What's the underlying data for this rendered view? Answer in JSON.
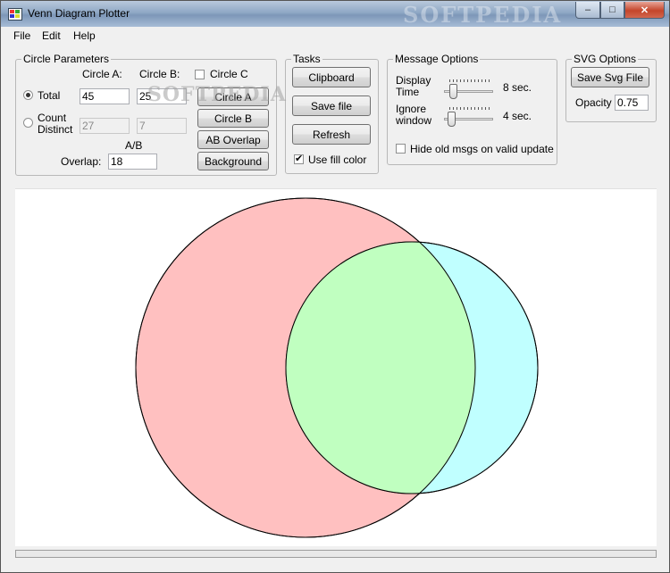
{
  "window": {
    "title": "Venn Diagram Plotter",
    "watermark": "SOFTPEDIA"
  },
  "titlebar_buttons": {
    "minimize": "–",
    "maximize": "□",
    "close": "✕"
  },
  "menu": [
    "File",
    "Edit",
    "Help"
  ],
  "circle_params": {
    "legend": "Circle Parameters",
    "col_a": "Circle A:",
    "col_b": "Circle B:",
    "circle_c_label": "Circle C",
    "circle_c_checked": false,
    "total_label": "Total",
    "total_selected": true,
    "count_distinct_label_1": "Count",
    "count_distinct_label_2": "Distinct",
    "total_a": "45",
    "total_b": "25",
    "distinct_a": "27",
    "distinct_b": "7",
    "ab_label": "A/B",
    "overlap_label": "Overlap:",
    "overlap_value": "18",
    "btn_circle_a": "Circle A",
    "btn_circle_b": "Circle B",
    "btn_ab_overlap": "AB Overlap",
    "btn_background": "Background"
  },
  "tasks": {
    "legend": "Tasks",
    "clipboard": "Clipboard",
    "save_file": "Save file",
    "refresh": "Refresh",
    "use_fill_label": "Use fill color",
    "use_fill_checked": true
  },
  "message_options": {
    "legend": "Message Options",
    "display_time_1": "Display",
    "display_time_2": "Time",
    "display_value": "8 sec.",
    "display_level": 0.1,
    "ignore_1": "Ignore",
    "ignore_2": "window",
    "ignore_value": "4 sec.",
    "ignore_level": 0.05,
    "hide_old_label": "Hide old msgs on valid update",
    "hide_old_checked": false
  },
  "svg_options": {
    "legend": "SVG Options",
    "save_svg": "Save Svg File",
    "opacity_label": "Opacity",
    "opacity_value": "0.75"
  },
  "colors": {
    "circle_a_fill": "#ffc0c0",
    "circle_b_fill": "#c0ffff",
    "overlap_fill": "#c0ffc0",
    "stroke": "#000000"
  }
}
